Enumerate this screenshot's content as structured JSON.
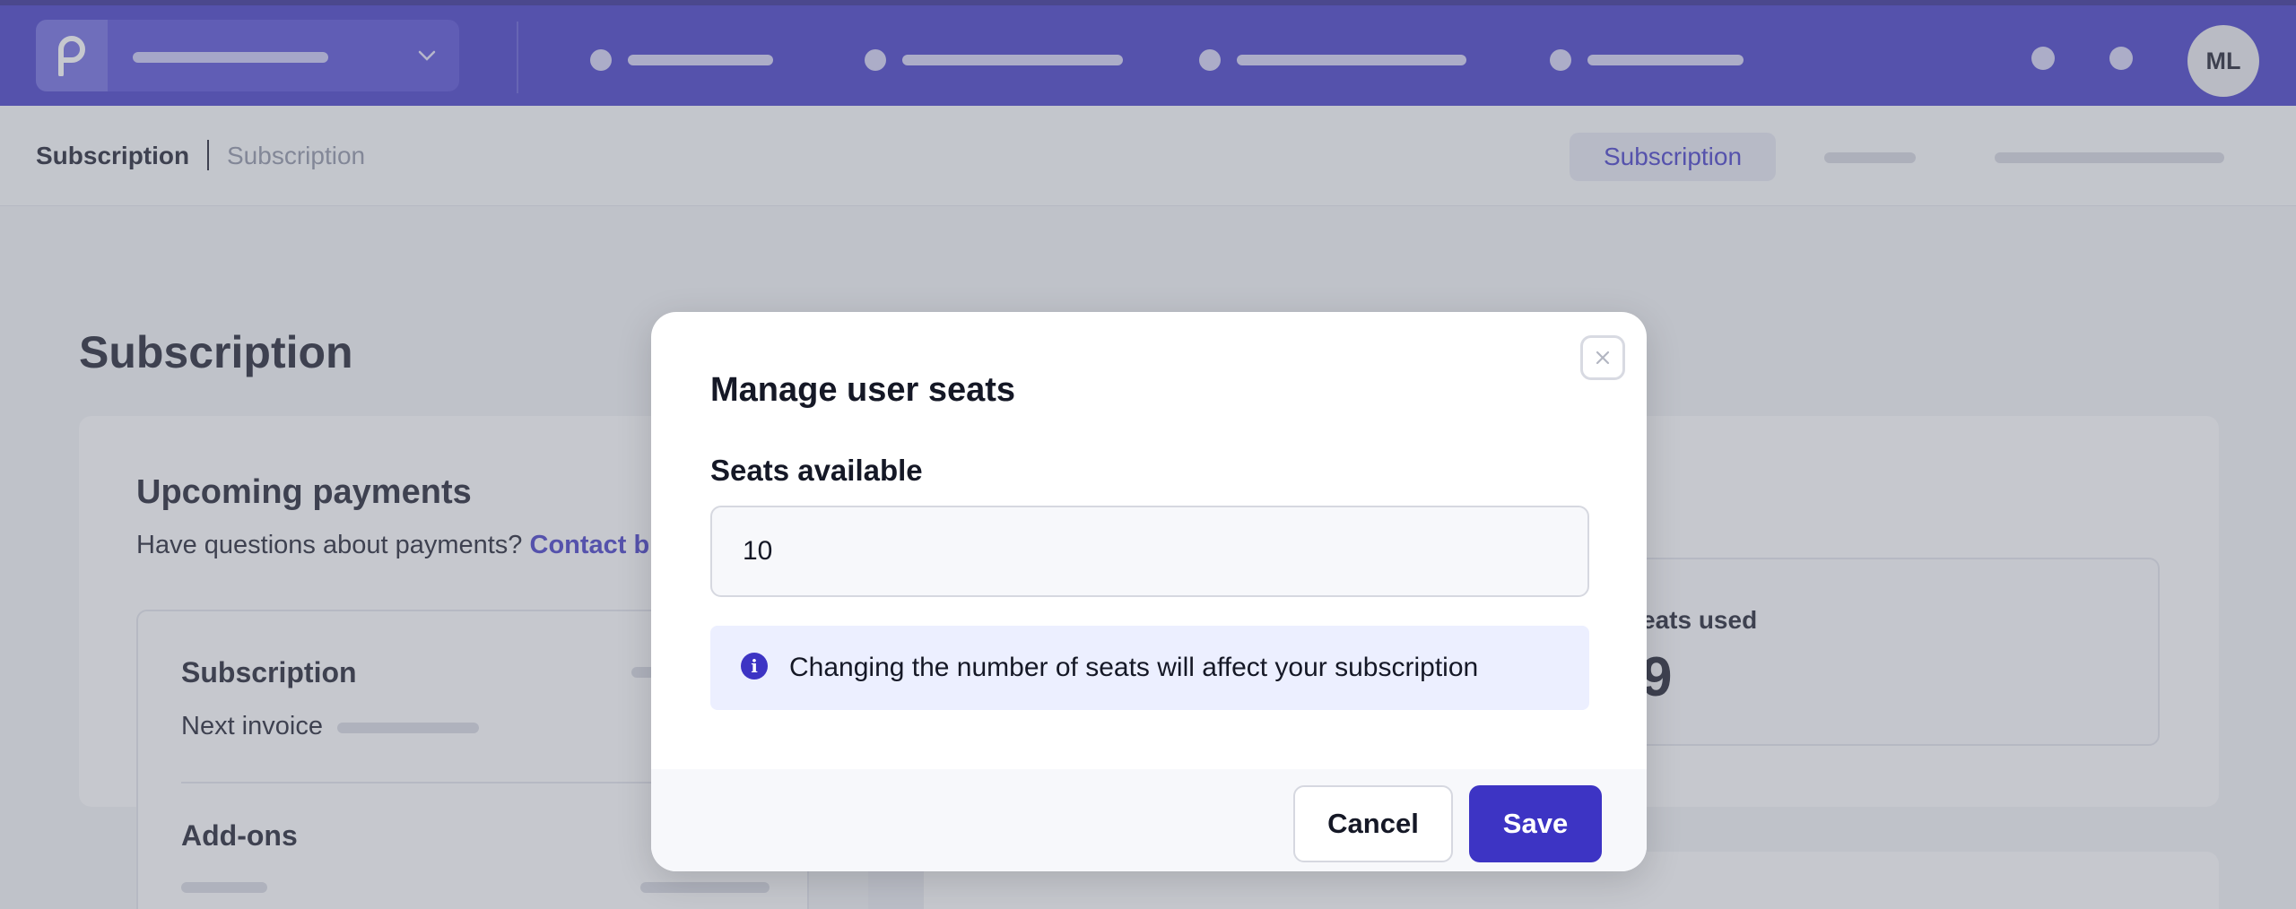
{
  "topbar": {
    "logo_icon": "brand-p-icon",
    "org_dropdown_icon": "chevron-down-icon",
    "avatar_initials": "ML"
  },
  "subheader": {
    "breadcrumb_title": "Subscription",
    "breadcrumb_sub": "Subscription",
    "active_tab": "Subscription"
  },
  "page": {
    "title": "Subscription",
    "upcoming_title": "Upcoming payments",
    "upcoming_question": "Have questions about payments?",
    "upcoming_link": "Contact b",
    "payment_item_title": "Subscription",
    "payment_item_next": "Next invoice",
    "addons_title": "Add-ons",
    "seats_used_label": "eats used",
    "seats_used_value": "9"
  },
  "modal": {
    "title": "Manage user seats",
    "field_label": "Seats available",
    "seats_value": "10",
    "info_icon": "info-icon",
    "info_text": "Changing the number of seats will affect your subscription",
    "close_icon": "close-icon",
    "cancel_label": "Cancel",
    "save_label": "Save"
  },
  "colors": {
    "brand": "#3d34c4",
    "overlay": "#787c8a",
    "info_bg": "#ecefff"
  }
}
